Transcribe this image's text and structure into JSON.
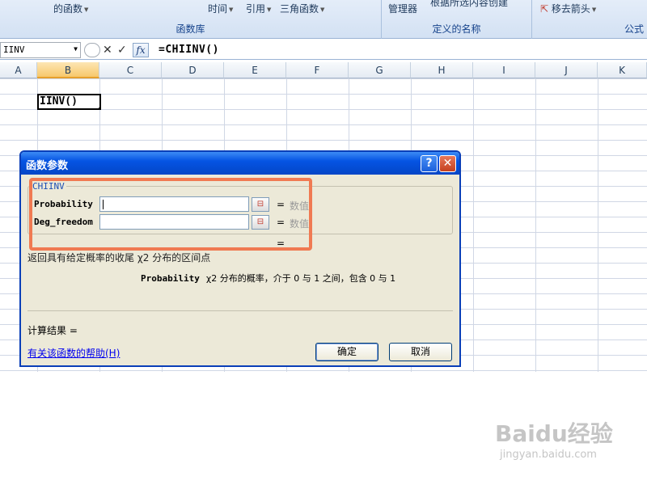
{
  "ribbon": {
    "groups": [
      {
        "label": "函数库",
        "items": [
          "的函数",
          "时间",
          "引用",
          "三角函数"
        ]
      },
      {
        "label": "定义的名称",
        "items": [
          "管理器",
          "根据所选内容创建"
        ]
      },
      {
        "label": "公式",
        "items": [
          "移去箭头"
        ]
      }
    ]
  },
  "formula_bar": {
    "name_box": "IINV",
    "cancel_symbol": "✕",
    "enter_symbol": "✓",
    "fx_label": "fx",
    "formula": "=CHIINV()"
  },
  "grid": {
    "columns": [
      "A",
      "B",
      "C",
      "D",
      "E",
      "F",
      "G",
      "H",
      "I",
      "J",
      "K"
    ],
    "selected_column": "B",
    "active_cell_text": "IINV()"
  },
  "dialog": {
    "title": "函数参数",
    "help_glyph": "?",
    "close_glyph": "✕",
    "function_name": "CHIINV",
    "args": [
      {
        "label": "Probability",
        "eq": "=",
        "hint": "数值"
      },
      {
        "label": "Deg_freedom",
        "eq": "=",
        "hint": "数值"
      }
    ],
    "formula_result_eq": "=",
    "description": "返回具有给定概率的收尾 χ2 分布的区间点",
    "param_name": "Probability",
    "param_desc": "χ2 分布的概率，介于 0 与 1 之间，包含 0 与 1",
    "result_label": "计算结果 =",
    "help_link": "有关该函数的帮助(H)",
    "ok_label": "确定",
    "cancel_label": "取消"
  },
  "watermark": {
    "logo": "Baidu经验",
    "url": "jingyan.baidu.com"
  }
}
